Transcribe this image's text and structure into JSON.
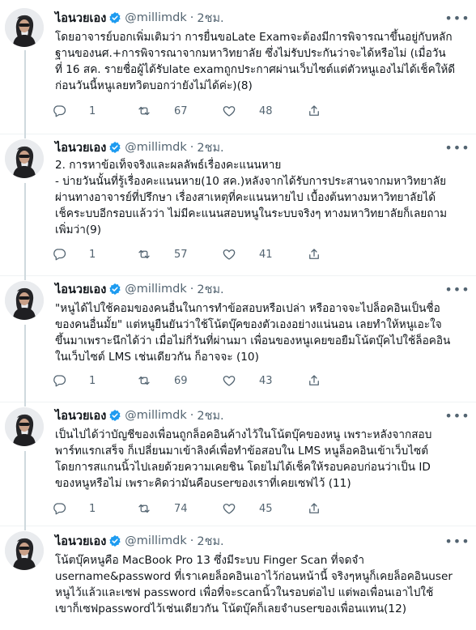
{
  "author": {
    "name": "ไอนวยเอง",
    "handle": "@millimdk",
    "time": "2ชม."
  },
  "colors": {
    "verified": "#1d9bf0",
    "text": "#0f1419",
    "muted": "#536471",
    "divider": "#eff3f4"
  },
  "icons": {
    "verified": "verified-badge-icon",
    "reply": "reply-icon",
    "retweet": "retweet-icon",
    "like": "heart-icon",
    "share": "share-icon",
    "more": "more-options-icon"
  },
  "tweets": [
    {
      "text": "โดยอาจารย์บอกเพิ่มเติมว่า การยื่นขอLate Examจะต้องมีการพิจารณาขึ้นอยู่กับหลัก\nฐานของนศ.+การพิจารณาจากมหาวิทยาลัย ซึ่งไม่รับประกันว่าจะได้หรือไม่ (เมื่อวัน\nที่ 16 สค. รายชื่อผู้ได้รับlate examถูกประกาศผ่านเว็บไซต์แต่ตัวหนูเองไม่ได้เช็คให้ดี\nก่อนวันนี้หนูเลยทวิตบอกว่ายังไม่ได้ค่ะ)(8)",
      "replies": "1",
      "retweets": "67",
      "likes": "48"
    },
    {
      "text": "2. การหาข้อเท็จจริงและผลลัพธ์เรื่องคะแนนหาย\n- บ่ายวันนั้นที่รู้เรื่องคะแนนหาย(10 สค.)หลังจากได้รับการประสานจากมหาวิทยาลัย\nผ่านทางอาจารย์ที่ปรึกษา เรื่องสาเหตุที่คะแนนหายไป เบื้องต้นทางมหาวิทยาลัยได้\nเช็คระบบอีกรอบแล้วว่า ไม่มีคะแนนสอบหนูในระบบจริงๆ ทางมหาวิทยาลัยก็เลยถาม\nเพิ่มว่า(9)",
      "replies": "1",
      "retweets": "57",
      "likes": "41"
    },
    {
      "text": "\"หนูได้ไปใช้คอมของคนอื่นในการทำข้อสอบหรือเปล่า หรืออาจจะไปล็อคอินเป็นชื่อ\nของคนอื่นมั้ย\" แต่หนูยืนยันว่าใช้โน้ตบุ๊คของตัวเองอย่างแน่นอน เลยทำให้หนูเอะใจ\nขึ้นมาเพราะนึกได้ว่า เมื่อไม่กี่วันที่ผ่านมา เพื่อนของหนูเคยขอยืมโน้ตบุ๊คไปใช้ล็อคอิน\nในเว็บไซต์ LMS เช่นเดียวกัน ก็อาจจะ (10)",
      "replies": "1",
      "retweets": "69",
      "likes": "43"
    },
    {
      "text": "เป็นไปได้ว่าบัญชีของเพื่อนถูกล็อคอินค้างไว้ในโน้ตบุ๊คของหนู เพราะหลังจากสอบ\nพาร์ทแรกเสร็จ ก็เปลี่ยนมาเข้าลิงค์เพื่อทำข้อสอบใน LMS หนูล็อคอินเข้าเว็บไซต์\nโดยการสแกนนิ้วไปเลยด้วยความเคยชิน โดยไม่ได้เช็คให้รอบคอบก่อนว่าเป็น ID\nของหนูหรือไม่ เพราะคิดว่ามันคือuserของเราที่เคยเซฟไว้ (11)",
      "replies": "1",
      "retweets": "74",
      "likes": "45"
    },
    {
      "text": "โน้ตบุ๊คหนูคือ MacBook Pro 13 ซึ่งมีระบบ Finger Scan ที่จดจำ\nusername&password ที่เราเคยล็อคอินเอาไว้ก่อนหน้านี้ จริงๆหนูก็เคยล็อคอินuser\nหนูไว้แล้วและเซฟ password เพื่อที่จะscanนิ้วในรอบต่อไป แต่พอเพื่อนเอาไปใช้\nเขาก็เซฟpasswordไว้เช่นเดียวกัน โน้ตบุ๊คก็เลยจำuserของเพื่อนแทน(12)",
      "replies": "",
      "retweets": "",
      "likes": ""
    }
  ]
}
